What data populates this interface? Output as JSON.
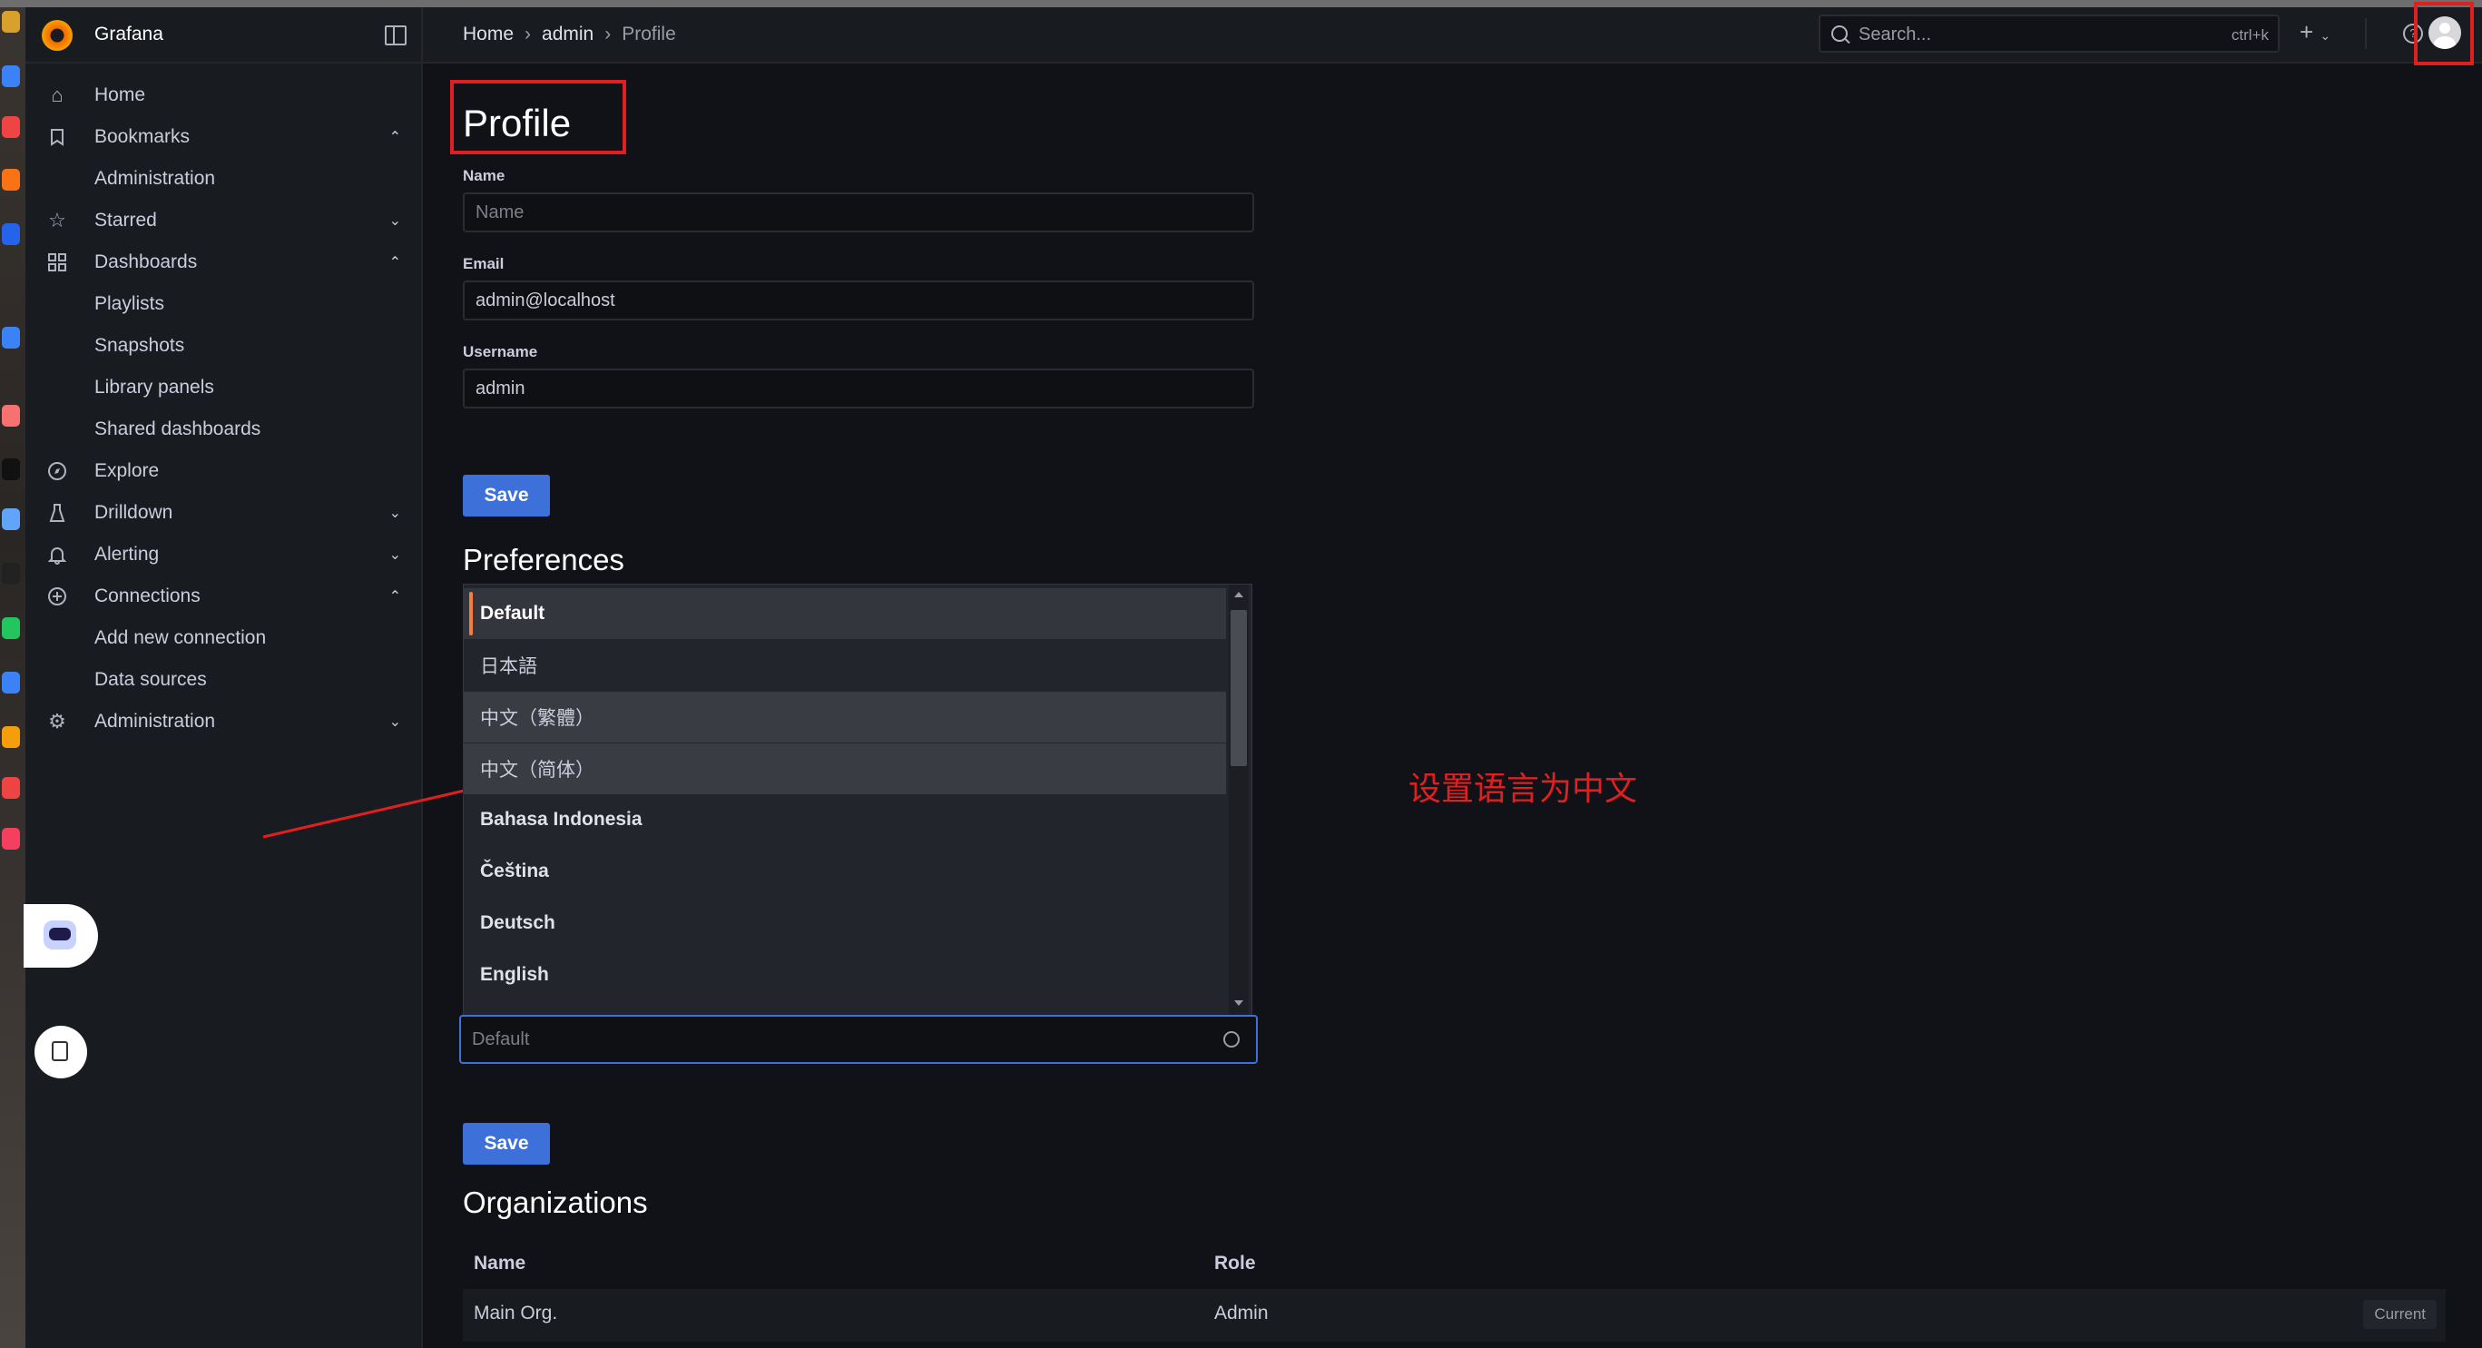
{
  "app": {
    "name": "Grafana"
  },
  "breadcrumb": [
    "Home",
    "admin",
    "Profile"
  ],
  "search": {
    "placeholder": "Search...",
    "shortcut": "ctrl+k"
  },
  "sidebar": {
    "items": [
      {
        "label": "Home",
        "icon": "home-icon"
      },
      {
        "label": "Bookmarks",
        "icon": "bookmark-icon",
        "expanded": true
      },
      {
        "label": "Administration",
        "sub": true
      },
      {
        "label": "Starred",
        "icon": "star-icon",
        "expanded": false
      },
      {
        "label": "Dashboards",
        "icon": "apps-icon",
        "expanded": true
      },
      {
        "label": "Playlists",
        "sub": true
      },
      {
        "label": "Snapshots",
        "sub": true
      },
      {
        "label": "Library panels",
        "sub": true
      },
      {
        "label": "Shared dashboards",
        "sub": true
      },
      {
        "label": "Explore",
        "icon": "compass-icon"
      },
      {
        "label": "Drilldown",
        "icon": "drilldown-icon",
        "expanded": false
      },
      {
        "label": "Alerting",
        "icon": "bell-icon",
        "expanded": false
      },
      {
        "label": "Connections",
        "icon": "connections-icon",
        "expanded": true
      },
      {
        "label": "Add new connection",
        "sub": true
      },
      {
        "label": "Data sources",
        "sub": true
      },
      {
        "label": "Administration",
        "icon": "cog-icon",
        "expanded": false
      }
    ]
  },
  "profile": {
    "title": "Profile",
    "name_label": "Name",
    "name_placeholder": "Name",
    "email_label": "Email",
    "email_value": "admin@localhost",
    "username_label": "Username",
    "username_value": "admin",
    "save_label": "Save"
  },
  "preferences": {
    "title": "Preferences",
    "language_options": [
      "Default",
      "日本語",
      "中文（繁體）",
      "中文（简体）",
      "Bahasa Indonesia",
      "Čeština",
      "Deutsch",
      "English"
    ],
    "selected": "Default",
    "input_placeholder": "Default",
    "save_label": "Save"
  },
  "annotation": {
    "text": "设置语言为中文",
    "color": "#e02020"
  },
  "organizations": {
    "title": "Organizations",
    "columns": [
      "Name",
      "Role"
    ],
    "rows": [
      {
        "name": "Main Org.",
        "role": "Admin",
        "badge": "Current"
      }
    ]
  },
  "colors": {
    "accent_blue": "#3d71d9",
    "selected_bar": "#f47e3f",
    "background": "#111217",
    "panel": "#181b1f"
  }
}
